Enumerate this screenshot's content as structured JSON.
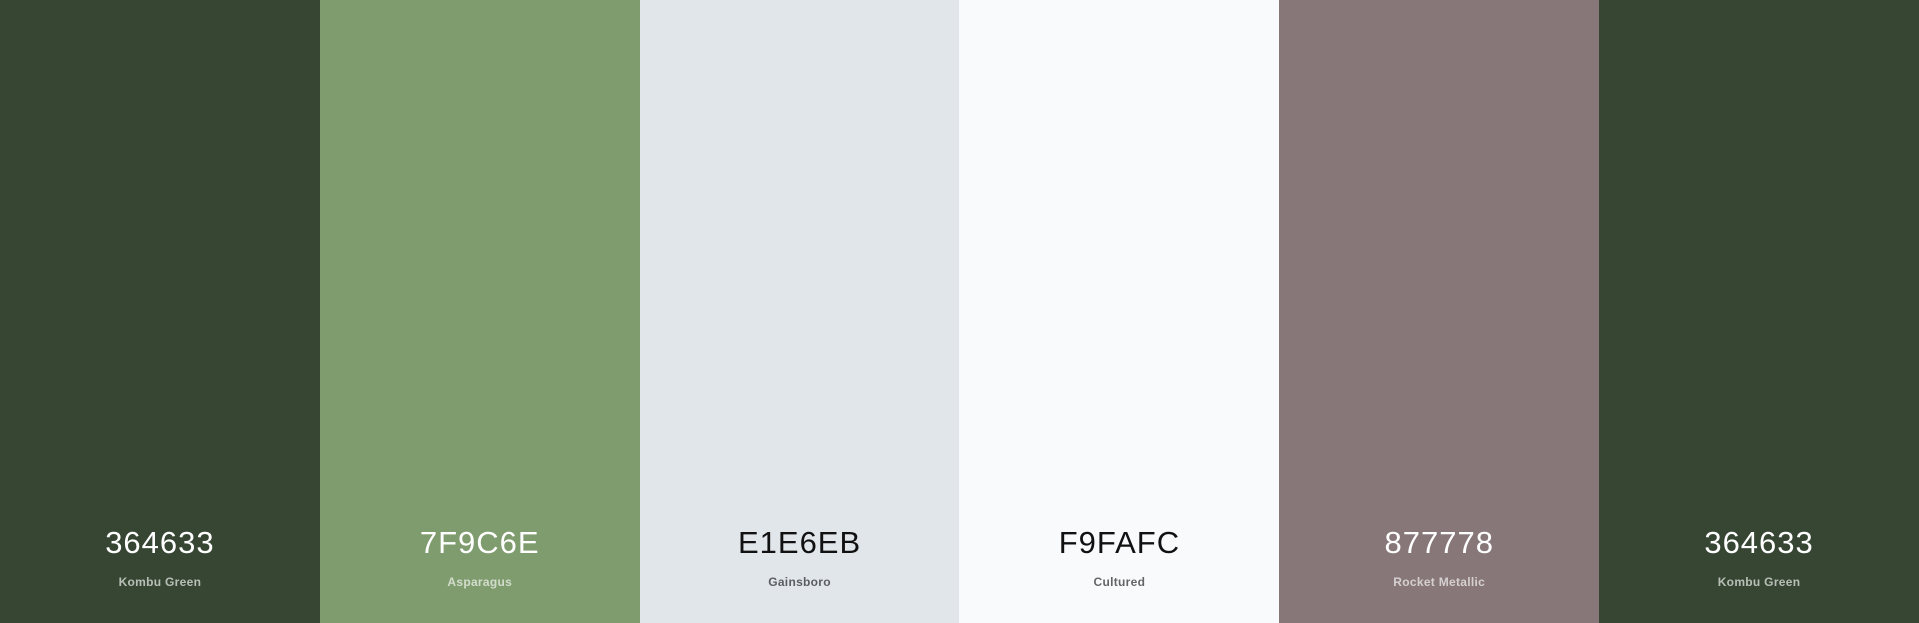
{
  "palette": {
    "swatches": [
      {
        "hex": "364633",
        "name": "Kombu Green",
        "color": "#364633",
        "tone": "dark"
      },
      {
        "hex": "7F9C6E",
        "name": "Asparagus",
        "color": "#7F9C6E",
        "tone": "dark"
      },
      {
        "hex": "E1E6EB",
        "name": "Gainsboro",
        "color": "#E1E6EB",
        "tone": "light"
      },
      {
        "hex": "F9FAFC",
        "name": "Cultured",
        "color": "#F9FAFC",
        "tone": "light"
      },
      {
        "hex": "877778",
        "name": "Rocket Metallic",
        "color": "#877778",
        "tone": "dark"
      },
      {
        "hex": "364633",
        "name": "Kombu Green",
        "color": "#364633",
        "tone": "dark"
      }
    ]
  }
}
